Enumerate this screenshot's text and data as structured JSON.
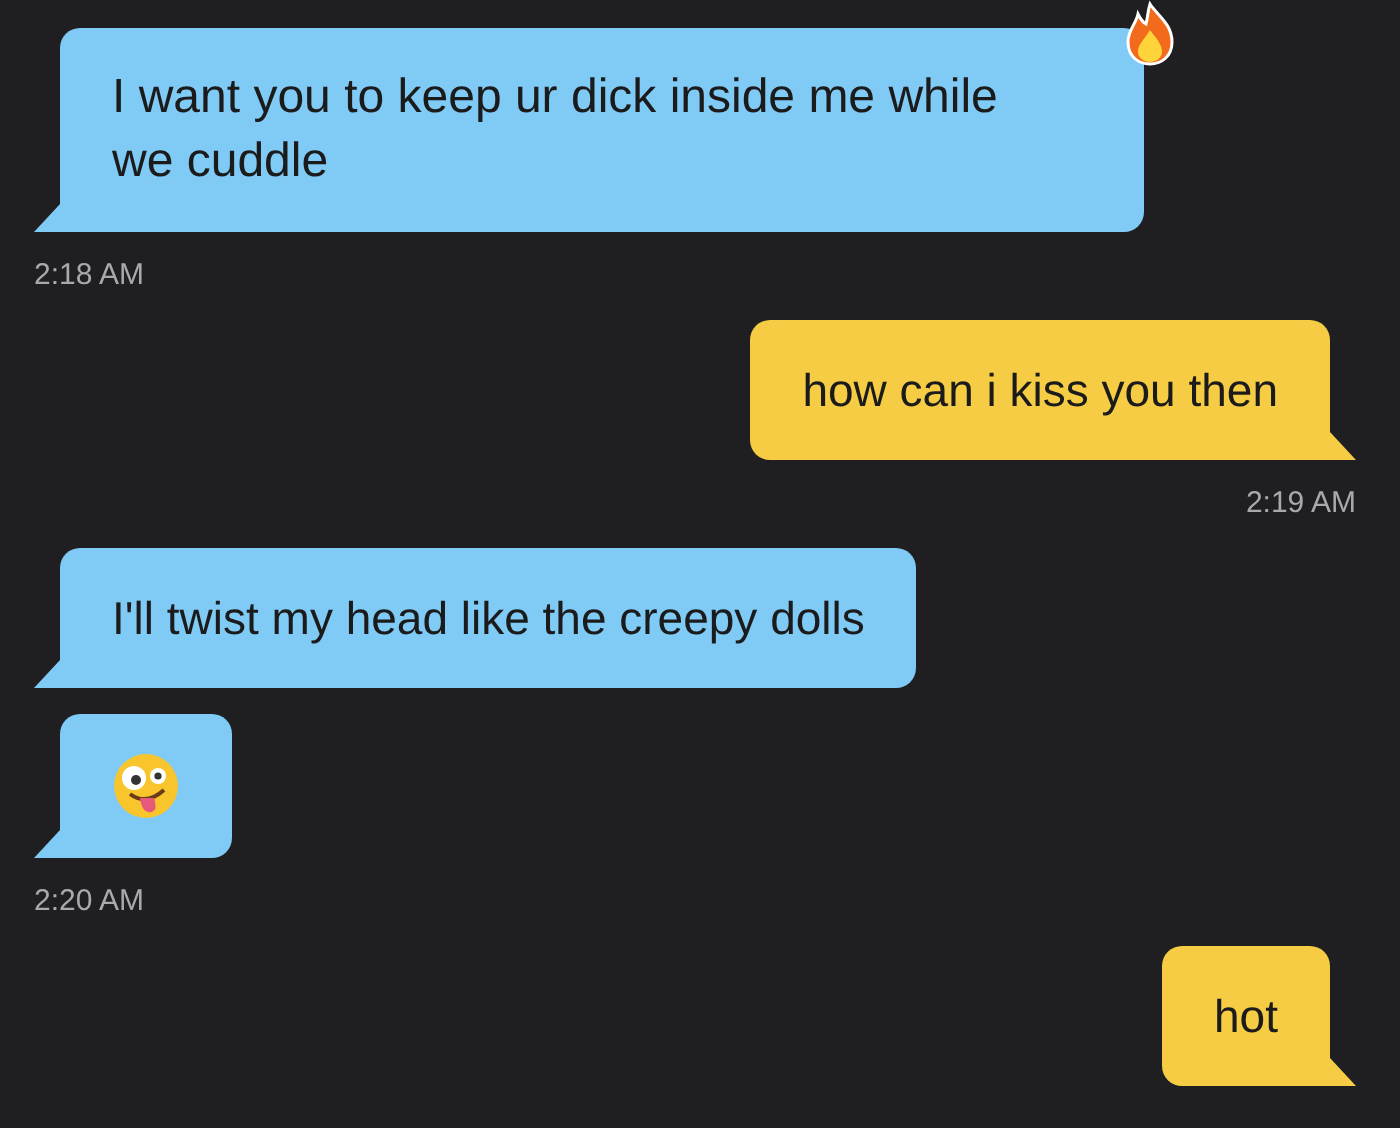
{
  "messages": [
    {
      "kind": "text",
      "outgoing": false,
      "text": "I want you to keep ur dick inside me while we cuddle",
      "reacted": true
    },
    {
      "kind": "time",
      "outgoing": false,
      "text": "2:18 AM"
    },
    {
      "kind": "text",
      "outgoing": true,
      "text": "how can i kiss you then",
      "reacted": false
    },
    {
      "kind": "time",
      "outgoing": true,
      "text": "2:19 AM"
    },
    {
      "kind": "text",
      "outgoing": false,
      "text": "I'll twist my head like the creepy dolls",
      "reacted": false
    },
    {
      "kind": "emoji",
      "outgoing": false
    },
    {
      "kind": "time",
      "outgoing": false,
      "text": "2:20 AM"
    },
    {
      "kind": "text",
      "outgoing": true,
      "text": "hot",
      "reacted": false
    }
  ]
}
